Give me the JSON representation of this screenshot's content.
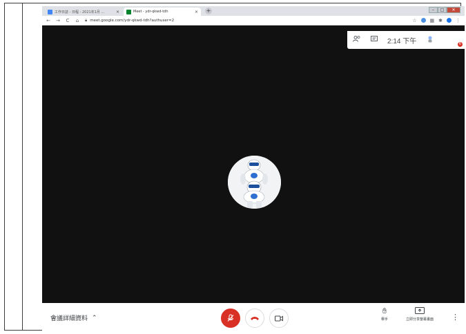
{
  "tabs": [
    {
      "title": "工作日誌 - 日程 - 2021年1月 ...",
      "favicon_color": "#4285f4",
      "close_label": "×"
    },
    {
      "title": "Meet - ydr-qkwd-tdh",
      "favicon_color": "#00832d",
      "close_label": "×"
    }
  ],
  "new_tab_label": "+",
  "address": {
    "url": "meet.google.com/ydr-qkwd-tdh?authuser=2"
  },
  "top_panel": {
    "time": "2:14 下午",
    "notification_count": "6"
  },
  "bottom_bar": {
    "meeting_details_label": "會議詳細資料",
    "raise_hand_label": "舉手",
    "present_now_label": "立即分享螢幕畫面"
  },
  "colors": {
    "stage": "#111111",
    "mic_off": "#d93025",
    "end_call": "#d93025"
  }
}
